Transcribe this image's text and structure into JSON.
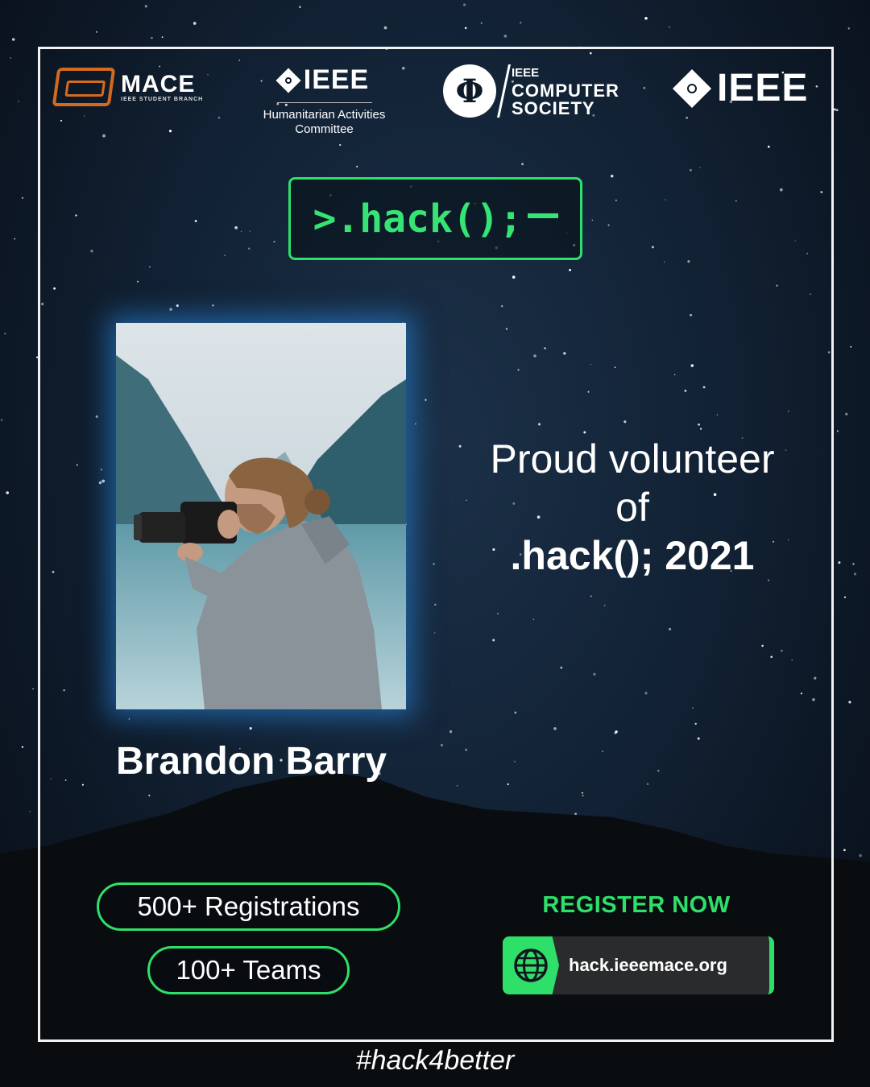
{
  "logos": {
    "mace_name": "MACE",
    "mace_sub": "IEEE STUDENT BRANCH",
    "hac_ieee": "IEEE",
    "hac_line1": "Humanitarian Activities",
    "hac_line2": "Committee",
    "cs_symbol": "Φ",
    "cs_ieee": "IEEE",
    "cs_line1": "COMPUTER",
    "cs_line2": "SOCIETY",
    "ieee": "IEEE"
  },
  "hack_title": ">.hack();",
  "photo": {
    "alt": "volunteer photo",
    "icon": "camera-photographer-image"
  },
  "volunteer": {
    "line1": "Proud volunteer",
    "line2": "of",
    "line3": ".hack(); 2021"
  },
  "person_name": "Brandon Barry",
  "stats": {
    "registrations": "500+ Registrations",
    "teams": "100+ Teams"
  },
  "register": {
    "label": "REGISTER NOW",
    "url": "hack.ieeemace.org",
    "icon": "globe-icon"
  },
  "hashtag": "#hack4better",
  "colors": {
    "accent_green": "#2ee06a",
    "mace_orange": "#d46a1e",
    "glow_blue": "#288ce6"
  }
}
